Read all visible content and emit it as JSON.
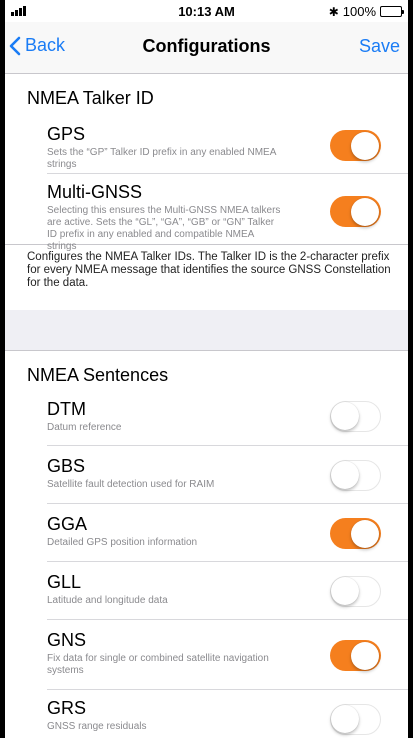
{
  "status": {
    "time": "10:13 AM",
    "battery": "100%",
    "bluetooth": "✱"
  },
  "nav": {
    "back": "Back",
    "title": "Configurations",
    "save": "Save"
  },
  "talker": {
    "header": "NMEA Talker ID",
    "rows": [
      {
        "title": "GPS",
        "desc": "Sets the “GP” Talker ID prefix in any enabled NMEA strings",
        "on": true
      },
      {
        "title": "Multi-GNSS",
        "desc": "Selecting this ensures the Multi-GNSS NMEA talkers are active.  Sets the “GL”, “GA”, “GB” or “GN” Talker ID prefix in any enabled and compatible NMEA strings",
        "on": true
      }
    ],
    "footer": "Configures the NMEA Talker IDs. The Talker ID is the 2-character prefix for every NMEA message that identifies the source GNSS Constellation for the data."
  },
  "sentences": {
    "header": "NMEA Sentences",
    "rows": [
      {
        "title": "DTM",
        "desc": "Datum reference",
        "on": false
      },
      {
        "title": "GBS",
        "desc": "Satellite fault detection used for RAIM",
        "on": false
      },
      {
        "title": "GGA",
        "desc": "Detailed GPS position information",
        "on": true
      },
      {
        "title": "GLL",
        "desc": "Latitude and longitude data",
        "on": false
      },
      {
        "title": "GNS",
        "desc": "Fix data for single or combined satellite navigation systems",
        "on": true
      },
      {
        "title": "GRS",
        "desc": "GNSS range residuals",
        "on": false
      }
    ]
  },
  "colors": {
    "accent": "#f57f1e",
    "link": "#1a7cf5"
  }
}
